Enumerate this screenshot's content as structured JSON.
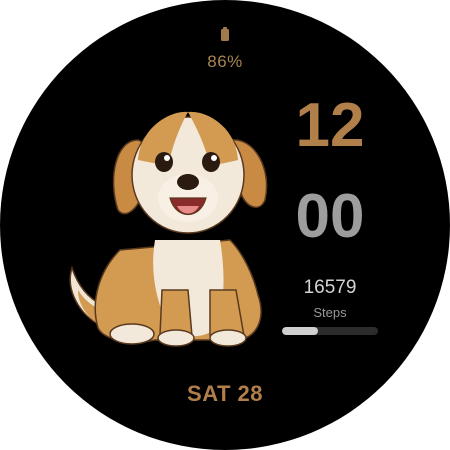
{
  "battery": {
    "icon": "battery-icon",
    "percent_text": "86%",
    "level": 0.86
  },
  "time": {
    "hours": "12",
    "minutes": "00"
  },
  "steps": {
    "value": "16579",
    "label": "Steps",
    "progress": 0.38
  },
  "date": {
    "text": "SAT 28"
  },
  "illustration": {
    "icon": "puppy-illustration"
  },
  "colors": {
    "background": "#000000",
    "accent": "#b17f4a",
    "minutes": "#9d9d9d",
    "steps_text": "#d4d4d4",
    "progress_fill": "#cfcfcf",
    "progress_track": "#2c2c2c"
  }
}
